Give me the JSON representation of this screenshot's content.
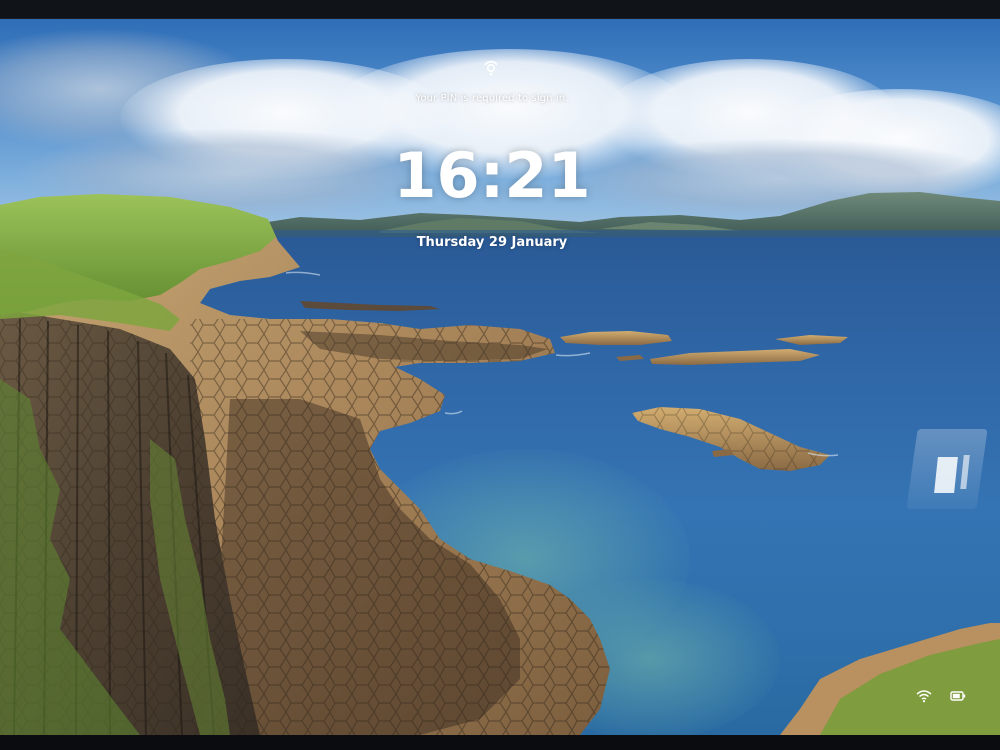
{
  "lock_screen": {
    "sign_in_message": "Your PIN is required to sign in.",
    "time": "16:21",
    "date": "Thursday 29 January"
  },
  "icons": {
    "sign_in_status": "sign-in-status-icon",
    "network": "wifi-icon",
    "battery": "battery-icon"
  },
  "colors": {
    "text": "#ffffff",
    "sky": "#4f8ccc",
    "sea": "#3574b4",
    "cliff_grass": "#8bb24a",
    "basalt": "#5a4a3a"
  }
}
